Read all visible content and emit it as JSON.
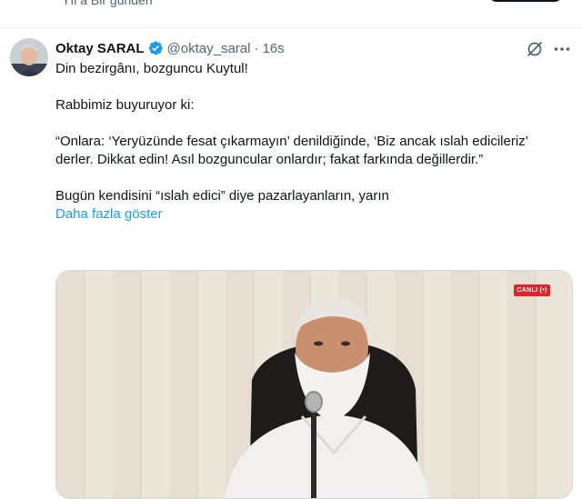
{
  "topbar": {
    "faded_text": "Yıl a Bir günden"
  },
  "tweet": {
    "author_name": "Oktay SARAL",
    "handle": "@oktay_saral",
    "separator": "·",
    "time": "16s",
    "lines": [
      "Din bezirgânı, bozguncu Kuytul!",
      "Rabbimiz buyuruyor ki:",
      "“Onlara: ‘Yeryüzünde fesat çıkarmayın’ denildiğinde, ‘Biz ancak ıslah edicileriz’ derler. Dikkat edin! Asıl bozguncular onlardır; fakat farkında değillerdir.”",
      "Bugün kendisini “ıslah edici” diye pazarlayanların, yarın"
    ],
    "show_more": "Daha fazla göster",
    "media": {
      "live_badge": "CANLI (•)"
    }
  },
  "icons": {
    "verified": "verified-badge-icon",
    "grok": "grok-icon",
    "more": "more-icon"
  },
  "colors": {
    "link": "#1d9bf0",
    "verified": "#1d9bf0",
    "secondary": "#536471",
    "live": "#e0242b"
  }
}
